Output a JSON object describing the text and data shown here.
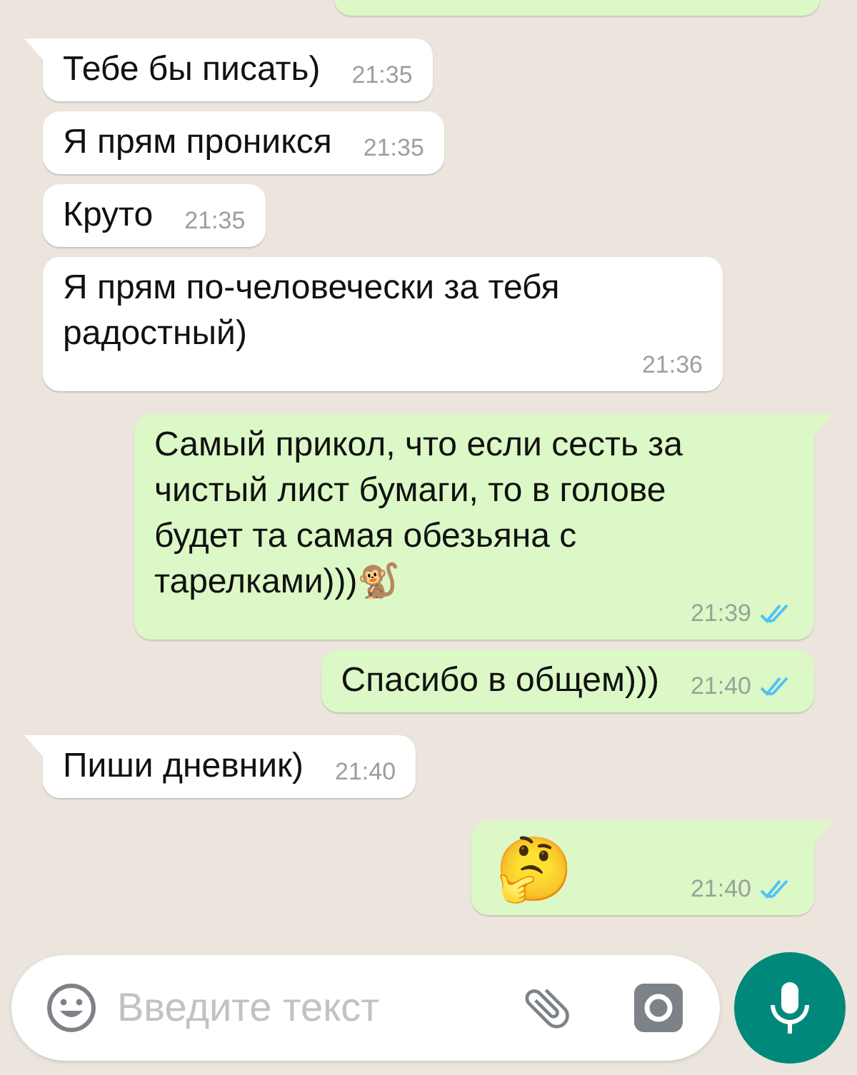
{
  "messages": [
    {
      "outgoing": true,
      "kind": "cut"
    },
    {
      "outgoing": false,
      "kind": "text",
      "tail": true,
      "text": "Тебе бы писать)",
      "time": "21:35"
    },
    {
      "outgoing": false,
      "kind": "text",
      "tail": false,
      "text": "Я прям проникся",
      "time": "21:35"
    },
    {
      "outgoing": false,
      "kind": "text",
      "tail": false,
      "text": "Круто",
      "time": "21:35"
    },
    {
      "outgoing": false,
      "kind": "text",
      "tail": false,
      "text": "Я прям по-человечески за тебя радостный)",
      "time": "21:36"
    },
    {
      "outgoing": true,
      "kind": "text",
      "tail": true,
      "text": "Самый прикол, что если сесть за чистый лист бумаги, то в голове будет та самая обезьяна с тарелками)))🐒",
      "time": "21:39",
      "read": true
    },
    {
      "outgoing": true,
      "kind": "text",
      "tail": false,
      "text": "Спасибо в общем)))",
      "time": "21:40",
      "read": true
    },
    {
      "outgoing": false,
      "kind": "text",
      "tail": true,
      "text": "Пиши дневник)",
      "time": "21:40"
    },
    {
      "outgoing": true,
      "kind": "emoji",
      "tail": true,
      "text": "🤔",
      "time": "21:40",
      "read": true
    }
  ],
  "composer": {
    "placeholder": "Введите текст"
  }
}
